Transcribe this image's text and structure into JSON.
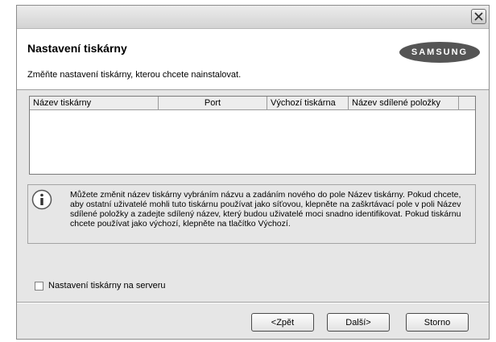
{
  "header": {
    "title": "Nastavení tiskárny",
    "subtitle": "Změňte nastavení tiskárny, kterou chcete nainstalovat.",
    "logo_text": "SAMSUNG"
  },
  "table": {
    "columns": [
      "Název tiskárny",
      "Port",
      "Výchozí tiskárna",
      "Název sdílené položky"
    ]
  },
  "info": {
    "text": "Můžete změnit název tiskárny vybráním názvu a zadáním nového do pole Název tiskárny. Pokud chcete, aby ostatní uživatelé mohli tuto tiskárnu používat jako síťovou, klepněte na zaškrtávací pole v poli Název sdílené položky a zadejte sdílený název, který budou uživatelé moci snadno identifikovat. Pokud tiskárnu chcete používat jako výchozí, klepněte na tlačítko Výchozí."
  },
  "checkbox": {
    "label": "Nastavení tiskárny na serveru",
    "checked": false
  },
  "buttons": {
    "back": "<Zpět",
    "next": "Další>",
    "cancel": "Storno"
  },
  "colors": {
    "accent": "#555555",
    "dialog_bg": "#e6e6e6"
  }
}
